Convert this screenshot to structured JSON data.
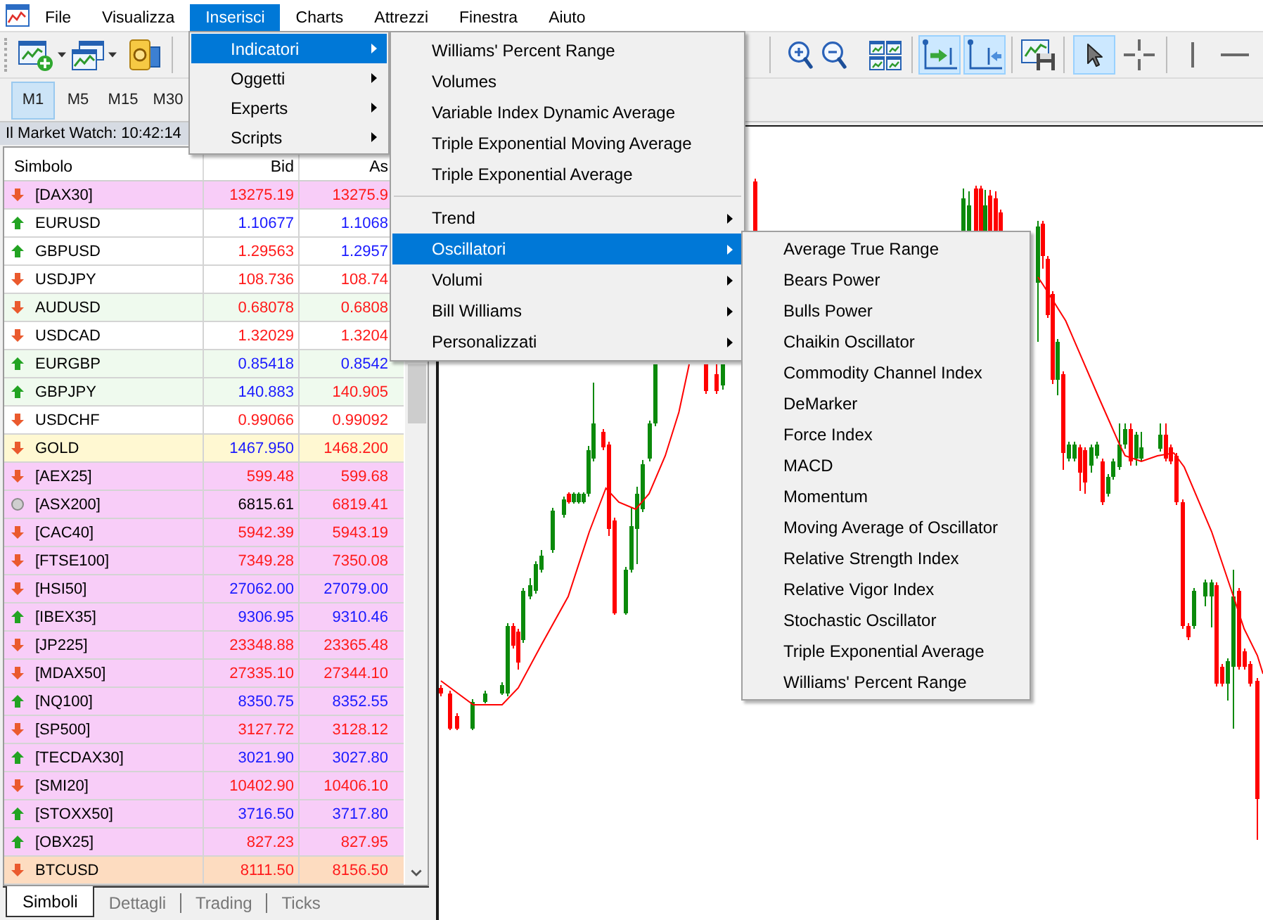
{
  "menu_bar": [
    {
      "label": "File",
      "selected": false
    },
    {
      "label": "Visualizza",
      "selected": false
    },
    {
      "label": "Inserisci",
      "selected": true
    },
    {
      "label": "Charts",
      "selected": false
    },
    {
      "label": "Attrezzi",
      "selected": false
    },
    {
      "label": "Finestra",
      "selected": false
    },
    {
      "label": "Aiuto",
      "selected": false
    }
  ],
  "toolbar_left": [
    {
      "kind": "chart_plus",
      "on": false
    },
    {
      "kind": "caret",
      "on": false
    },
    {
      "kind": "windows_stack",
      "on": false
    },
    {
      "kind": "caret",
      "on": false
    },
    {
      "kind": "coin",
      "on": false
    }
  ],
  "toolbar_right": [
    {
      "items": [
        {
          "kind": "zoom_in",
          "on": false
        },
        {
          "kind": "zoom_out",
          "on": false
        },
        {
          "kind": "tile",
          "on": false
        }
      ]
    },
    {
      "items": [
        {
          "kind": "shift",
          "on": true
        },
        {
          "kind": "autoscroll",
          "on": true
        }
      ]
    },
    {
      "items": [
        {
          "kind": "floppy",
          "on": false
        }
      ]
    },
    {
      "items": [
        {
          "kind": "cursor",
          "on": true
        },
        {
          "kind": "crosshair",
          "on": false
        }
      ]
    },
    {
      "items": [
        {
          "kind": "vline",
          "on": false
        },
        {
          "kind": "hline",
          "on": false
        }
      ]
    }
  ],
  "timeframes": [
    {
      "label": "M1",
      "selected": true
    },
    {
      "label": "M5",
      "selected": false
    },
    {
      "label": "M15",
      "selected": false
    },
    {
      "label": "M30",
      "selected": false
    }
  ],
  "market_watch": {
    "title": "Il Market Watch: 10:42:14",
    "columns": [
      "Simbolo",
      "Bid",
      "As"
    ],
    "rows": [
      {
        "symbol": "[DAX30]",
        "kind": "down",
        "color": "#f8cdf8",
        "bid": {
          "value": "13275.19",
          "color": "#ff1a1a"
        },
        "ask": {
          "value": "13275.9",
          "color": "#ff1a1a"
        }
      },
      {
        "symbol": "EURUSD",
        "kind": "up",
        "color": "#ffffff",
        "bid": {
          "value": "1.10677",
          "color": "#1a1aff"
        },
        "ask": {
          "value": "1.1068",
          "color": "#1a1aff"
        }
      },
      {
        "symbol": "GBPUSD",
        "kind": "up",
        "color": "#ffffff",
        "bid": {
          "value": "1.29563",
          "color": "#ff1a1a"
        },
        "ask": {
          "value": "1.2957",
          "color": "#1a1aff"
        }
      },
      {
        "symbol": "USDJPY",
        "kind": "down",
        "color": "#ffffff",
        "bid": {
          "value": "108.736",
          "color": "#ff1a1a"
        },
        "ask": {
          "value": "108.74",
          "color": "#ff1a1a"
        }
      },
      {
        "symbol": "AUDUSD",
        "kind": "down",
        "color": "#effaee",
        "bid": {
          "value": "0.68078",
          "color": "#ff1a1a"
        },
        "ask": {
          "value": "0.6808",
          "color": "#ff1a1a"
        }
      },
      {
        "symbol": "USDCAD",
        "kind": "down",
        "color": "#ffffff",
        "bid": {
          "value": "1.32029",
          "color": "#ff1a1a"
        },
        "ask": {
          "value": "1.3204",
          "color": "#ff1a1a"
        }
      },
      {
        "symbol": "EURGBP",
        "kind": "up",
        "color": "#effaee",
        "bid": {
          "value": "0.85418",
          "color": "#1a1aff"
        },
        "ask": {
          "value": "0.8542",
          "color": "#1a1aff"
        }
      },
      {
        "symbol": "GBPJPY",
        "kind": "up",
        "color": "#effaee",
        "bid": {
          "value": "140.883",
          "color": "#1a1aff"
        },
        "ask": {
          "value": "140.905",
          "color": "#ff1a1a"
        }
      },
      {
        "symbol": "USDCHF",
        "kind": "down",
        "color": "#ffffff",
        "bid": {
          "value": "0.99066",
          "color": "#ff1a1a"
        },
        "ask": {
          "value": "0.99092",
          "color": "#ff1a1a"
        }
      },
      {
        "symbol": "GOLD",
        "kind": "down",
        "color": "#fff8d2",
        "bid": {
          "value": "1467.950",
          "color": "#1a1aff"
        },
        "ask": {
          "value": "1468.200",
          "color": "#ff1a1a"
        }
      },
      {
        "symbol": "[AEX25]",
        "kind": "down",
        "color": "#f8cdf8",
        "bid": {
          "value": "599.48",
          "color": "#ff1a1a"
        },
        "ask": {
          "value": "599.68",
          "color": "#ff1a1a"
        }
      },
      {
        "symbol": "[ASX200]",
        "kind": "flat",
        "color": "#f8cdf8",
        "bid": {
          "value": "6815.61",
          "color": "#000000"
        },
        "ask": {
          "value": "6819.41",
          "color": "#ff1a1a"
        }
      },
      {
        "symbol": "[CAC40]",
        "kind": "down",
        "color": "#f8cdf8",
        "bid": {
          "value": "5942.39",
          "color": "#ff1a1a"
        },
        "ask": {
          "value": "5943.19",
          "color": "#ff1a1a"
        }
      },
      {
        "symbol": "[FTSE100]",
        "kind": "down",
        "color": "#f8cdf8",
        "bid": {
          "value": "7349.28",
          "color": "#ff1a1a"
        },
        "ask": {
          "value": "7350.08",
          "color": "#ff1a1a"
        }
      },
      {
        "symbol": "[HSI50]",
        "kind": "down",
        "color": "#f8cdf8",
        "bid": {
          "value": "27062.00",
          "color": "#1a1aff"
        },
        "ask": {
          "value": "27079.00",
          "color": "#1a1aff"
        }
      },
      {
        "symbol": "[IBEX35]",
        "kind": "up",
        "color": "#f8cdf8",
        "bid": {
          "value": "9306.95",
          "color": "#1a1aff"
        },
        "ask": {
          "value": "9310.46",
          "color": "#1a1aff"
        }
      },
      {
        "symbol": "[JP225]",
        "kind": "down",
        "color": "#f8cdf8",
        "bid": {
          "value": "23348.88",
          "color": "#ff1a1a"
        },
        "ask": {
          "value": "23365.48",
          "color": "#ff1a1a"
        }
      },
      {
        "symbol": "[MDAX50]",
        "kind": "down",
        "color": "#f8cdf8",
        "bid": {
          "value": "27335.10",
          "color": "#ff1a1a"
        },
        "ask": {
          "value": "27344.10",
          "color": "#ff1a1a"
        }
      },
      {
        "symbol": "[NQ100]",
        "kind": "up",
        "color": "#f8cdf8",
        "bid": {
          "value": "8350.75",
          "color": "#1a1aff"
        },
        "ask": {
          "value": "8352.55",
          "color": "#1a1aff"
        }
      },
      {
        "symbol": "[SP500]",
        "kind": "down",
        "color": "#f8cdf8",
        "bid": {
          "value": "3127.72",
          "color": "#ff1a1a"
        },
        "ask": {
          "value": "3128.12",
          "color": "#ff1a1a"
        }
      },
      {
        "symbol": "[TECDAX30]",
        "kind": "up",
        "color": "#f8cdf8",
        "bid": {
          "value": "3021.90",
          "color": "#1a1aff"
        },
        "ask": {
          "value": "3027.80",
          "color": "#1a1aff"
        }
      },
      {
        "symbol": "[SMI20]",
        "kind": "down",
        "color": "#f8cdf8",
        "bid": {
          "value": "10402.90",
          "color": "#ff1a1a"
        },
        "ask": {
          "value": "10406.10",
          "color": "#ff1a1a"
        }
      },
      {
        "symbol": "[STOXX50]",
        "kind": "up",
        "color": "#f8cdf8",
        "bid": {
          "value": "3716.50",
          "color": "#1a1aff"
        },
        "ask": {
          "value": "3717.80",
          "color": "#1a1aff"
        }
      },
      {
        "symbol": "[OBX25]",
        "kind": "up",
        "color": "#f8cdf8",
        "bid": {
          "value": "827.23",
          "color": "#ff1a1a"
        },
        "ask": {
          "value": "827.95",
          "color": "#ff1a1a"
        }
      },
      {
        "symbol": "BTCUSD",
        "kind": "down",
        "color": "#fddcc0",
        "bid": {
          "value": "8111.50",
          "color": "#ff1a1a"
        },
        "ask": {
          "value": "8156.50",
          "color": "#ff1a1a"
        }
      }
    ],
    "tabs": [
      {
        "label": "Simboli",
        "selected": true
      },
      {
        "label": "Dettagli",
        "selected": false
      },
      {
        "label": "Trading",
        "selected": false
      },
      {
        "label": "Ticks",
        "selected": false
      }
    ]
  },
  "insert_menu": {
    "items": [
      {
        "label": "Indicatori",
        "submenu": true,
        "selected": true
      },
      {
        "label": "Oggetti",
        "submenu": true,
        "selected": false
      },
      {
        "label": "Experts",
        "submenu": true,
        "selected": false
      },
      {
        "label": "Scripts",
        "submenu": true,
        "selected": false
      }
    ]
  },
  "indicators_menu": {
    "sections": [
      {
        "items": [
          {
            "label": "Williams' Percent Range",
            "submenu": false,
            "selected": false
          },
          {
            "label": "Volumes",
            "submenu": false,
            "selected": false
          },
          {
            "label": "Variable Index Dynamic Average",
            "submenu": false,
            "selected": false
          },
          {
            "label": "Triple Exponential Moving Average",
            "submenu": false,
            "selected": false
          },
          {
            "label": "Triple Exponential Average",
            "submenu": false,
            "selected": false
          }
        ]
      },
      {
        "items": [
          {
            "label": "Trend",
            "submenu": true,
            "selected": false
          },
          {
            "label": "Oscillatori",
            "submenu": true,
            "selected": true
          },
          {
            "label": "Volumi",
            "submenu": true,
            "selected": false
          },
          {
            "label": "Bill Williams",
            "submenu": true,
            "selected": false
          },
          {
            "label": "Personalizzati",
            "submenu": true,
            "selected": false
          }
        ]
      }
    ]
  },
  "oscillators_menu": {
    "items": [
      {
        "label": "Average True Range",
        "submenu": false,
        "selected": false
      },
      {
        "label": "Bears Power",
        "submenu": false,
        "selected": false
      },
      {
        "label": "Bulls Power",
        "submenu": false,
        "selected": false
      },
      {
        "label": "Chaikin Oscillator",
        "submenu": false,
        "selected": false
      },
      {
        "label": "Commodity Channel Index",
        "submenu": false,
        "selected": false
      },
      {
        "label": "DeMarker",
        "submenu": false,
        "selected": false
      },
      {
        "label": "Force Index",
        "submenu": false,
        "selected": false
      },
      {
        "label": "MACD",
        "submenu": false,
        "selected": false
      },
      {
        "label": "Momentum",
        "submenu": false,
        "selected": false
      },
      {
        "label": "Moving Average of Oscillator",
        "submenu": false,
        "selected": false
      },
      {
        "label": "Relative Strength Index",
        "submenu": false,
        "selected": false
      },
      {
        "label": "Relative Vigor Index",
        "submenu": false,
        "selected": false
      },
      {
        "label": "Stochastic Oscillator",
        "submenu": false,
        "selected": false
      },
      {
        "label": "Triple Exponential Average",
        "submenu": false,
        "selected": false
      },
      {
        "label": "Williams' Percent Range",
        "submenu": false,
        "selected": false
      }
    ]
  }
}
